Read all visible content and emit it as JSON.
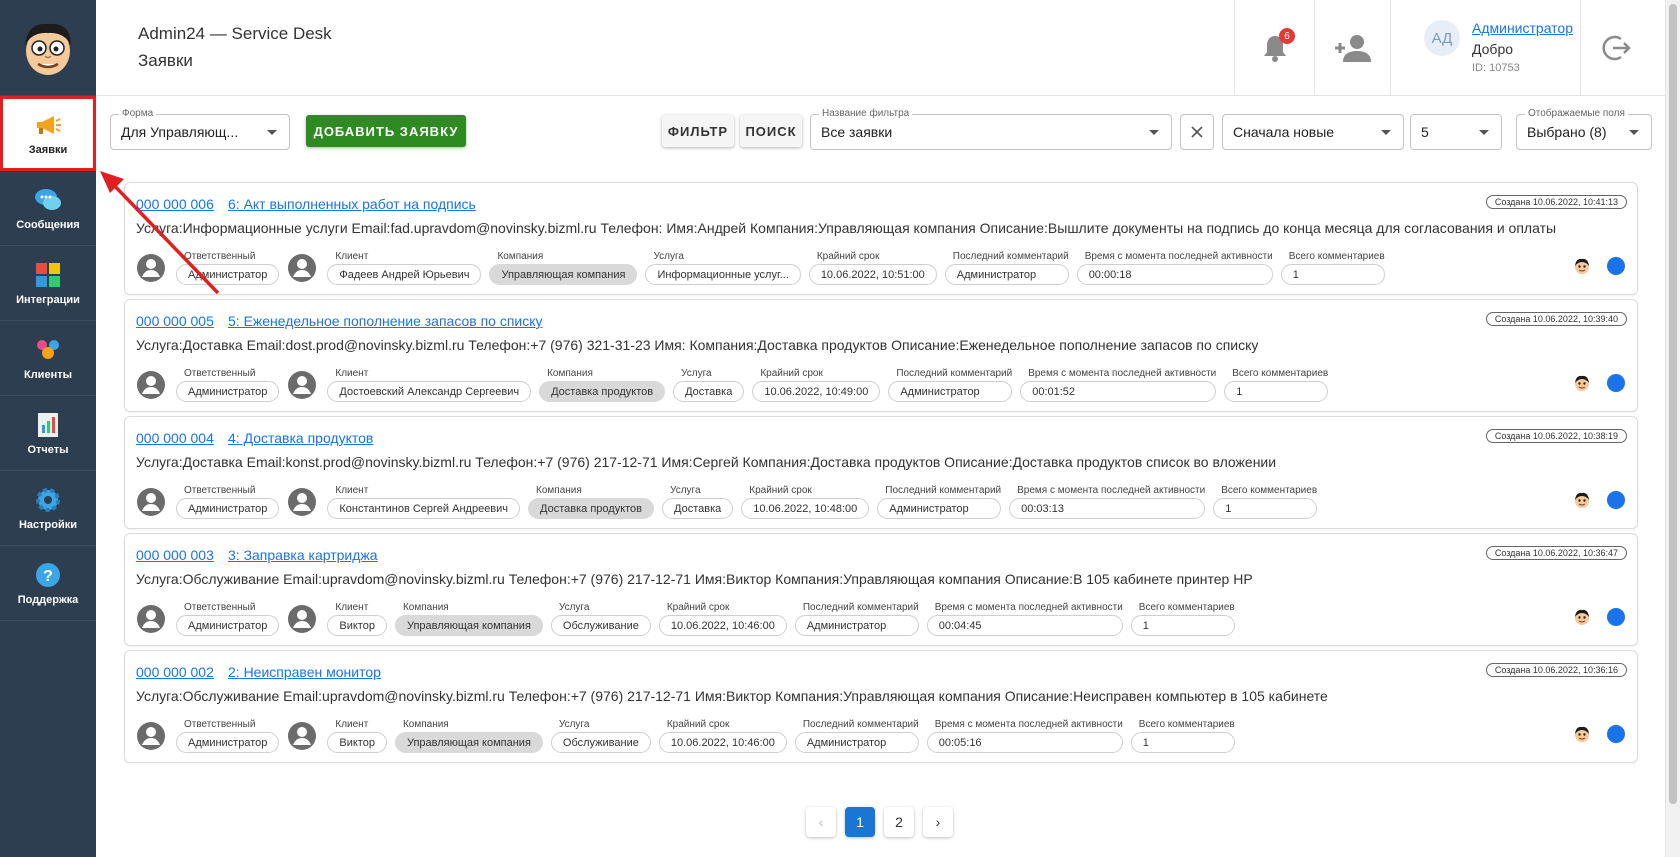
{
  "colors": {
    "sidebar": "#2d3e50",
    "accent": "#1a73e8",
    "add_button": "#2e8b22",
    "badge": "#e53935",
    "highlight": "#e02020"
  },
  "sidebar": {
    "items": [
      {
        "label": "Заявки",
        "icon": "megaphone-icon",
        "active": true
      },
      {
        "label": "Сообщения",
        "icon": "chat-bubbles-icon"
      },
      {
        "label": "Интеграции",
        "icon": "puzzle-icon"
      },
      {
        "label": "Клиенты",
        "icon": "people-icon"
      },
      {
        "label": "Отчеты",
        "icon": "report-icon"
      },
      {
        "label": "Настройки",
        "icon": "gear-icon"
      },
      {
        "label": "Поддержка",
        "icon": "help-icon"
      }
    ]
  },
  "header": {
    "app_title": "Admin24 — Service Desk",
    "page_title": "Заявки",
    "notifications_count": "6",
    "user": {
      "initials": "АД",
      "name": "Администратор",
      "greeting": "Добро",
      "id": "ID: 10753"
    }
  },
  "toolbar": {
    "form": {
      "label": "Форма",
      "value": "Для Управляющ..."
    },
    "add_button": "ДОБАВИТЬ ЗАЯВКУ",
    "filter_button": "ФИЛЬТР",
    "search_button": "ПОИСК",
    "filter_name": {
      "label": "Название фильтра",
      "value": "Все заявки"
    },
    "sort": {
      "value": "Сначала новые"
    },
    "per_page": {
      "value": "5"
    },
    "fields": {
      "label": "Отображаемые поля",
      "value": "Выбрано (8)"
    }
  },
  "field_labels": {
    "responsible": "Ответственный",
    "client": "Клиент",
    "company": "Компания",
    "service": "Услуга",
    "deadline": "Крайний срок",
    "last_comment": "Последний комментарий",
    "since_activity": "Время с момента последней активности",
    "total_comments": "Всего комментариев"
  },
  "tickets": [
    {
      "number": "000 000 006",
      "title": "6: Акт выполненных работ на подпись",
      "created": "Создана 10.06.2022, 10:41:13",
      "description": "Услуга:Информационные услуги Email:fad.upravdom@novinsky.bizml.ru Телефон: Имя:Андрей Компания:Управляющая компания Описание:Вышлите документы на подпись до конца месяца для согласования и оплаты",
      "responsible": "Администратор",
      "client": "Фадеев Андрей Юрьевич",
      "company": "Управляющая компания",
      "service": "Информационные услуг...",
      "deadline": "10.06.2022, 10:51:00",
      "last_comment": "Администратор",
      "since_activity": "00:00:18",
      "total_comments": "1"
    },
    {
      "number": "000 000 005",
      "title": "5: Еженедельное пополнение запасов по списку",
      "created": "Создана 10.06.2022, 10:39:40",
      "description": "Услуга:Доставка Email:dost.prod@novinsky.bizml.ru Телефон:+7 (976) 321-31-23 Имя: Компания:Доставка продуктов Описание:Еженедельное пополнение запасов по списку",
      "responsible": "Администратор",
      "client": "Достоевский Александр Сергеевич",
      "company": "Доставка продуктов",
      "service": "Доставка",
      "deadline": "10.06.2022, 10:49:00",
      "last_comment": "Администратор",
      "since_activity": "00:01:52",
      "total_comments": "1"
    },
    {
      "number": "000 000 004",
      "title": "4: Доставка продуктов",
      "created": "Создана 10.06.2022, 10:38:19",
      "description": "Услуга:Доставка Email:konst.prod@novinsky.bizml.ru Телефон:+7 (976) 217-12-71 Имя:Сергей Компания:Доставка продуктов Описание:Доставка продуктов список во вложении",
      "responsible": "Администратор",
      "client": "Константинов Сергей Андреевич",
      "company": "Доставка продуктов",
      "service": "Доставка",
      "deadline": "10.06.2022, 10:48:00",
      "last_comment": "Администратор",
      "since_activity": "00:03:13",
      "total_comments": "1"
    },
    {
      "number": "000 000 003",
      "title": "3: Заправка картриджа",
      "created": "Создана 10.06.2022, 10:36:47",
      "description": "Услуга:Обслуживание Email:upravdom@novinsky.bizml.ru Телефон:+7 (976) 217-12-71 Имя:Виктор Компания:Управляющая компания Описание:В 105 кабинете принтер HP",
      "responsible": "Администратор",
      "client": "Виктор",
      "company": "Управляющая компания",
      "service": "Обслуживание",
      "deadline": "10.06.2022, 10:46:00",
      "last_comment": "Администратор",
      "since_activity": "00:04:45",
      "total_comments": "1"
    },
    {
      "number": "000 000 002",
      "title": "2: Неисправен монитор",
      "created": "Создана 10.06.2022, 10:36:16",
      "description": "Услуга:Обслуживание Email:upravdom@novinsky.bizml.ru Телефон:+7 (976) 217-12-71 Имя:Виктор Компания:Управляющая компания Описание:Неисправен компьютер в 105 кабинете",
      "responsible": "Администратор",
      "client": "Виктор",
      "company": "Управляющая компания",
      "service": "Обслуживание",
      "deadline": "10.06.2022, 10:46:00",
      "last_comment": "Администратор",
      "since_activity": "00:05:16",
      "total_comments": "1"
    }
  ],
  "pagination": {
    "prev": "‹",
    "pages": [
      "1",
      "2"
    ],
    "current": "1",
    "next": "›"
  }
}
